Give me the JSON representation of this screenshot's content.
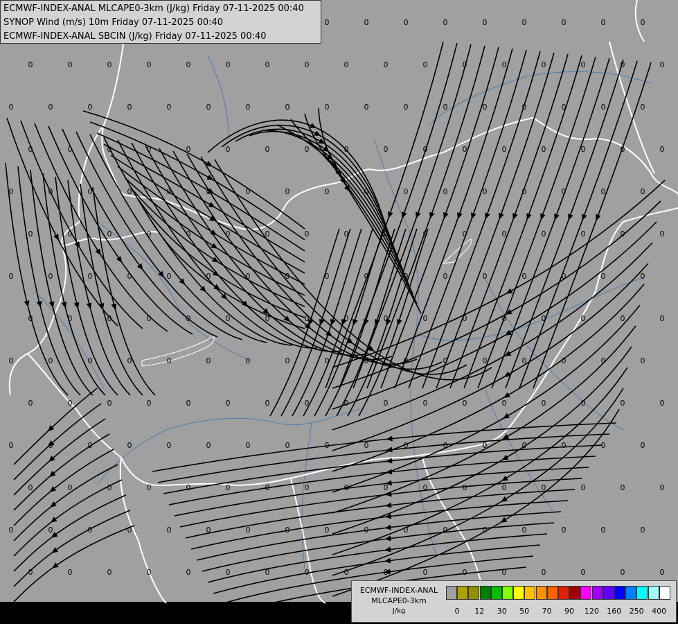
{
  "title": {
    "line1": "ECMWF-INDEX-ANAL MLCAPE0-3km (J/kg) Friday 07-11-2025 00:40",
    "line2": "SYNOP Wind (m/s) 10m Friday 07-11-2025 00:40",
    "line3": "ECMWF-INDEX-ANAL SBCIN (J/kg) Friday 07-11-2025 00:40"
  },
  "legend": {
    "label1": "ECMWF-INDEX-ANAL",
    "label2": "MLCAPE0-3km",
    "label3": "J/kg",
    "colors": [
      "#a0a0a0",
      "#b0a000",
      "#909000",
      "#008000",
      "#00c000",
      "#80ff00",
      "#ffff00",
      "#ffc000",
      "#ff9000",
      "#ff6000",
      "#e02000",
      "#a00000",
      "#ff00ff",
      "#a000ff",
      "#6000ff",
      "#0000ff",
      "#0080ff",
      "#00ffff",
      "#a0ffff",
      "#ffffff"
    ],
    "ticks": [
      "0",
      "12",
      "30",
      "50",
      "70",
      "90",
      "120",
      "160",
      "250",
      "400"
    ]
  },
  "colors": {
    "background": "#a0a0a0",
    "streamline": "#000000",
    "border": "#ffffff",
    "river": "#4a7fb5"
  },
  "value_label": "0"
}
